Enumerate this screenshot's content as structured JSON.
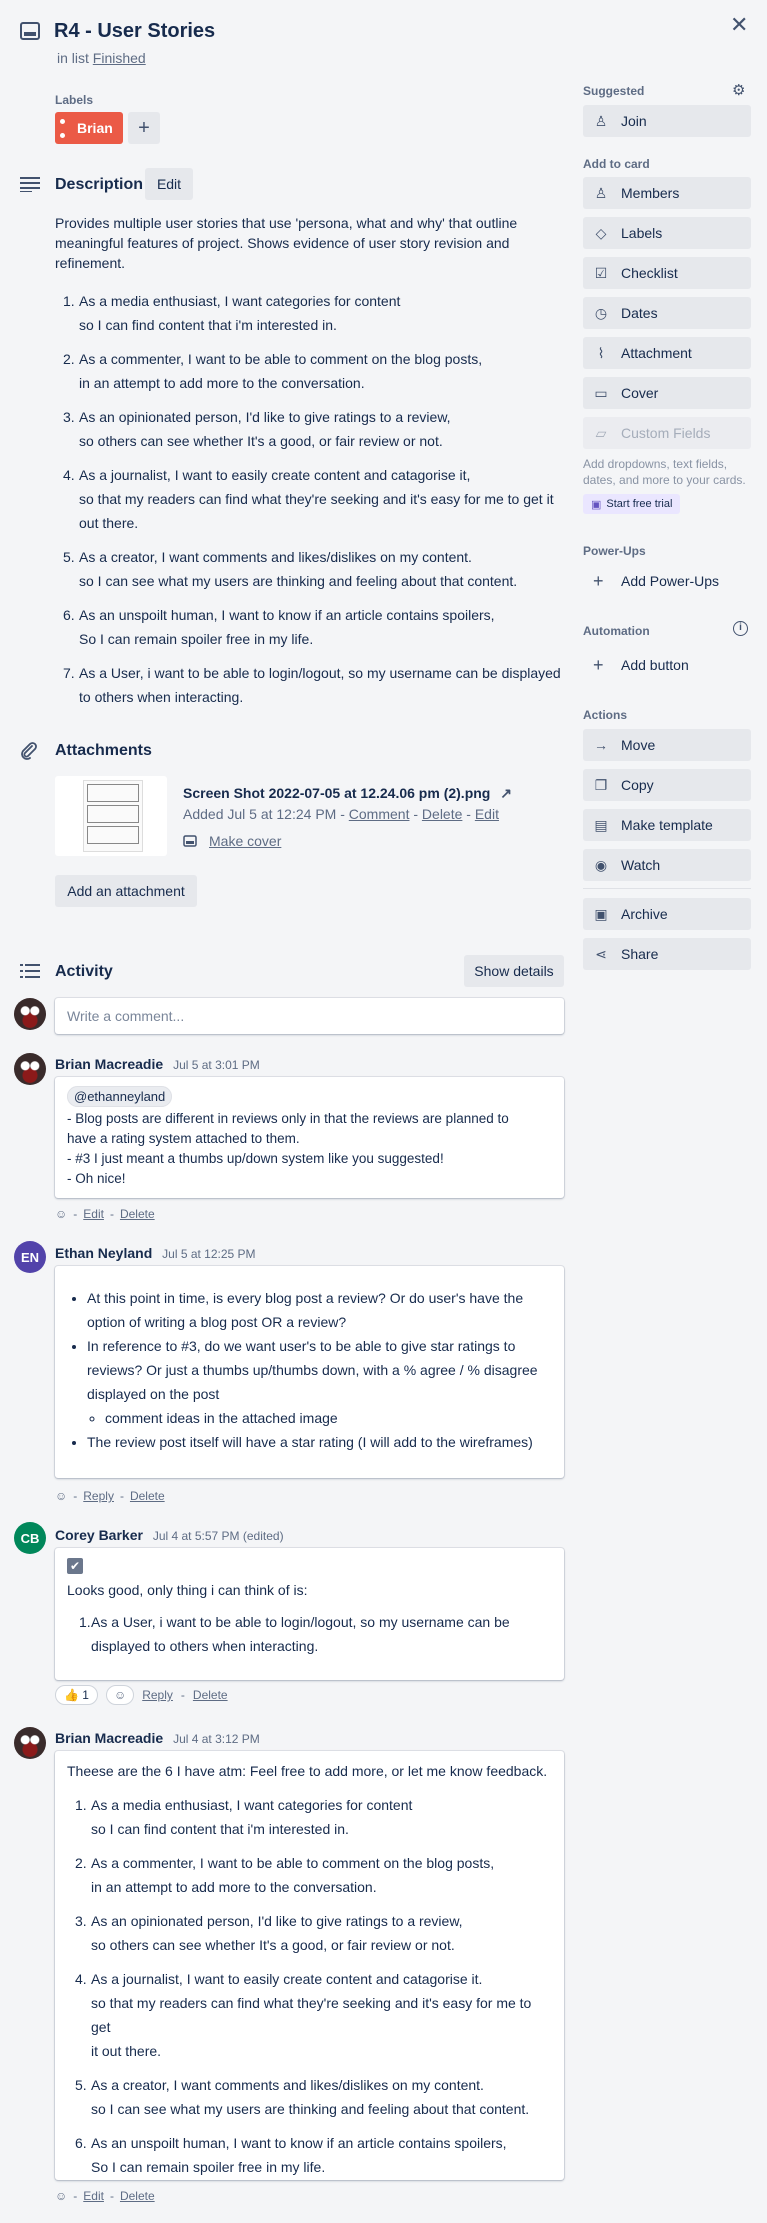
{
  "card": {
    "title": "R4 - User Stories",
    "in_list_prefix": "in list",
    "list_name": "Finished"
  },
  "labels": {
    "heading": "Labels",
    "items": [
      {
        "name": "Brian",
        "color": "#eb5a46"
      }
    ],
    "add_symbol": "+"
  },
  "description": {
    "heading": "Description",
    "edit_label": "Edit",
    "intro": "Provides multiple user stories that use 'persona, what and why' that outline meaningful features of project. Shows evidence of user story revision and refinement.",
    "stories": [
      {
        "num": "1.",
        "l1": "As a media enthusiast, I want categories for content",
        "l2": "so I can find content that i'm interested in."
      },
      {
        "num": "2.",
        "l1": "As a commenter, I want to be able to comment on the blog posts,",
        "l2": "in an attempt to add more to the conversation."
      },
      {
        "num": "3.",
        "l1": "As an opinionated person, I'd like to give ratings to a review,",
        "l2": "so others can see whether It's a good, or fair review or not."
      },
      {
        "num": "4.",
        "l1": "As a journalist, I want to easily create content and catagorise it,",
        "l2": "so that my readers can find what they're seeking and it's easy for me to get it",
        "l3": "out there."
      },
      {
        "num": "5.",
        "l1": "As a creator, I want comments and likes/dislikes on my content.",
        "l2": "so I can see what my users are thinking and feeling about that content."
      },
      {
        "num": "6.",
        "l1": "As an unspoilt human, I want to know if an article contains spoilers,",
        "l2": "So I can remain spoiler free in my life."
      },
      {
        "num": "7.",
        "l1": "As a User, i want to be able to login/logout, so my username can be displayed",
        "l2": "to others when interacting."
      }
    ]
  },
  "attachments": {
    "heading": "Attachments",
    "file_name": "Screen Shot 2022-07-05 at 12.24.06 pm (2).png",
    "added": "Added Jul 5 at 12:24 PM",
    "sep": "-",
    "comment_link": "Comment",
    "delete_link": "Delete",
    "edit_link": "Edit",
    "make_cover": "Make cover",
    "add_button": "Add an attachment"
  },
  "activity": {
    "heading": "Activity",
    "show_details": "Show details",
    "comment_placeholder": "Write a comment..."
  },
  "comments": [
    {
      "author": "Brian Macreadie",
      "time": "Jul 5 at 3:01 PM",
      "mention": "@ethanneyland",
      "lines": [
        "- Blog posts are different in reviews only in that the reviews are planned to",
        "have a rating system attached to them.",
        "- #3 I just meant a thumbs up/down system like you suggested!",
        "- Oh nice!"
      ],
      "actions": {
        "edit": "Edit",
        "delete": "Delete",
        "sep": "-"
      }
    },
    {
      "author": "Ethan Neyland",
      "initials": "EN",
      "avatar_color": "#5243aa",
      "time": "Jul 5 at 12:25 PM",
      "bullets": [
        {
          "l1": "At this point in time, is every blog post a review? Or do user's have the",
          "l2": "option of writing a blog post OR a review?"
        },
        {
          "l1": "In reference to #3, do we want user's to be able to give star ratings to",
          "l2": "reviews? Or just a thumbs up/thumbs down, with a % agree / % disagree",
          "l3": "displayed on the post"
        },
        {
          "l1": "The review post itself will have a star rating (I will add to the wireframes)"
        }
      ],
      "sub_bullet": "comment ideas in the attached image",
      "actions": {
        "reply": "Reply",
        "delete": "Delete",
        "sep": "-"
      }
    },
    {
      "author": "Corey Barker",
      "initials": "CB",
      "avatar_color": "#00875a",
      "time": "Jul 4 at 5:57 PM (edited)",
      "check_emoji": "✔",
      "text": "Looks good, only thing i can think of is:",
      "item_num": "1.",
      "item_l1": "As a User, i want to be able to login/logout, so my username can be",
      "item_l2": "displayed to others when interacting.",
      "reaction": "👍 1",
      "actions": {
        "reply": "Reply",
        "delete": "Delete"
      }
    },
    {
      "author": "Brian Macreadie",
      "time": "Jul 4 at 3:12 PM",
      "intro": "Theese are the 6 I have atm: Feel free to add more, or let me know feedback.",
      "stories": [
        {
          "num": "1.",
          "l1": "As a media enthusiast, I want categories for content",
          "l2": "so I can find content that i'm interested in."
        },
        {
          "num": "2.",
          "l1": "As a commenter, I want to be able to comment on the blog posts,",
          "l2": "in an attempt to add more to the conversation."
        },
        {
          "num": "3.",
          "l1": "As an opinionated person, I'd like to give ratings to a review,",
          "l2": "so others can see whether It's a good, or fair review or not."
        },
        {
          "num": "4.",
          "l1": "As a journalist, I want to easily create content and catagorise it.",
          "l2": "so that my readers can find what they're seeking and it's easy for me to get",
          "l3": "it out there."
        },
        {
          "num": "5.",
          "l1": "As a creator, I want comments and likes/dislikes on my content.",
          "l2": "so I can see what my users are thinking and feeling about that content."
        },
        {
          "num": "6.",
          "l1": "As an unspoilt human, I want to know if an article contains spoilers,",
          "l2": "So I can remain spoiler free in my life."
        }
      ],
      "actions": {
        "edit": "Edit",
        "delete": "Delete",
        "sep": "-"
      }
    }
  ],
  "sidebar": {
    "suggested": "Suggested",
    "join": "Join",
    "add_to_card": "Add to card",
    "members": "Members",
    "labels": "Labels",
    "checklist": "Checklist",
    "dates": "Dates",
    "attachment": "Attachment",
    "cover": "Cover",
    "custom_fields": "Custom Fields",
    "custom_fields_help": "Add dropdowns, text fields, dates, and more to your cards.",
    "start_trial": "Start free trial",
    "powerups": "Power-Ups",
    "add_powerups": "Add Power-Ups",
    "automation": "Automation",
    "add_button": "Add button",
    "actions": "Actions",
    "move": "Move",
    "copy": "Copy",
    "make_template": "Make template",
    "watch": "Watch",
    "archive": "Archive",
    "share": "Share"
  }
}
